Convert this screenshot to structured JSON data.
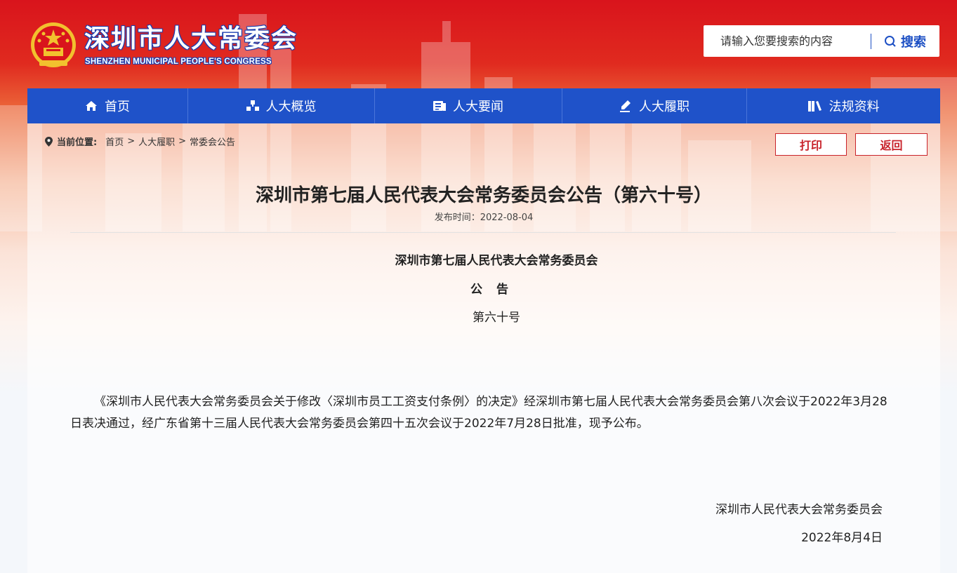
{
  "header": {
    "title": "深圳市人大常委会",
    "subtitle": "SHENZHEN MUNICIPAL PEOPLE'S CONGRESS"
  },
  "search": {
    "placeholder": "请输入您要搜索的内容",
    "button_label": "搜索"
  },
  "nav": {
    "items": [
      {
        "label": "首页",
        "icon": "home-icon"
      },
      {
        "label": "人大概览",
        "icon": "structure-icon"
      },
      {
        "label": "人大要闻",
        "icon": "news-icon"
      },
      {
        "label": "人大履职",
        "icon": "pen-icon"
      },
      {
        "label": "法规资料",
        "icon": "books-icon"
      }
    ]
  },
  "breadcrumb": {
    "label": "当前位置:",
    "items": [
      "首页",
      "人大履职",
      "常委会公告"
    ],
    "separator": ">"
  },
  "actions": {
    "print_label": "打印",
    "back_label": "返回"
  },
  "article": {
    "title": "深圳市第七届人民代表大会常务委员会公告（第六十号）",
    "publish_time": "发布时间：2022-08-04",
    "org_line": "深圳市第七届人民代表大会常务委员会",
    "notice_line": "公告",
    "number_line": "第六十号",
    "body": "《深圳市人民代表大会常务委员会关于修改〈深圳市员工工资支付条例〉的决定》经深圳市第七届人民代表大会常务委员会第八次会议于2022年3月28日表决通过，经广东省第十三届人民代表大会常务委员会第四十五次会议于2022年7月28日批准，现予公布。",
    "signature_org": "深圳市人民代表大会常务委员会",
    "signature_date": "2022年8月4日"
  },
  "colors": {
    "header_red": "#d9141c",
    "nav_blue": "#1f52c9",
    "button_red": "#c8232b",
    "emblem_gold": "#f2c12e"
  }
}
